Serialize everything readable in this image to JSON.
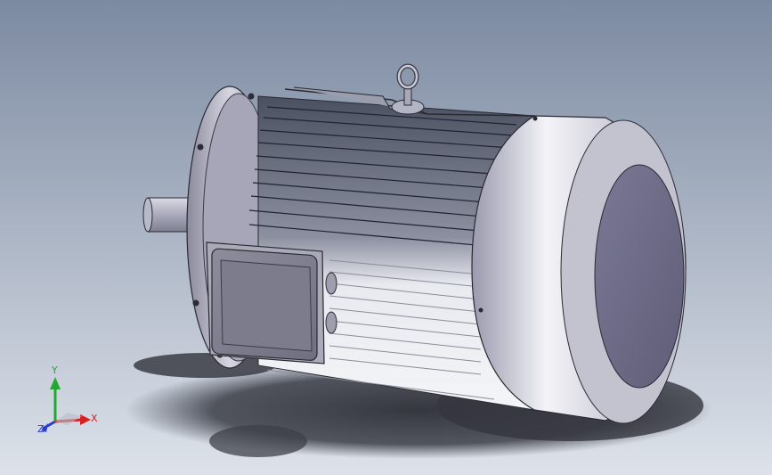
{
  "viewport": {
    "background_top": "#7c8aa1",
    "background_bottom": "#dde2ea"
  },
  "model": {
    "name": "electric-motor",
    "colors": {
      "body_light": "#f2f2f6",
      "body_mid": "#b3b3c2",
      "body_dark": "#6d6d80",
      "fan_cover_face": "#6e6d88",
      "fins_dark": "#4f5464",
      "fins_light": "#e6e8ef",
      "shadow": "#3b3d45"
    }
  },
  "triad": {
    "x_label": "X",
    "y_label": "Y",
    "z_label": "Z",
    "x_color": "#d42020",
    "y_color": "#22a832",
    "z_color": "#2a3cc8"
  }
}
